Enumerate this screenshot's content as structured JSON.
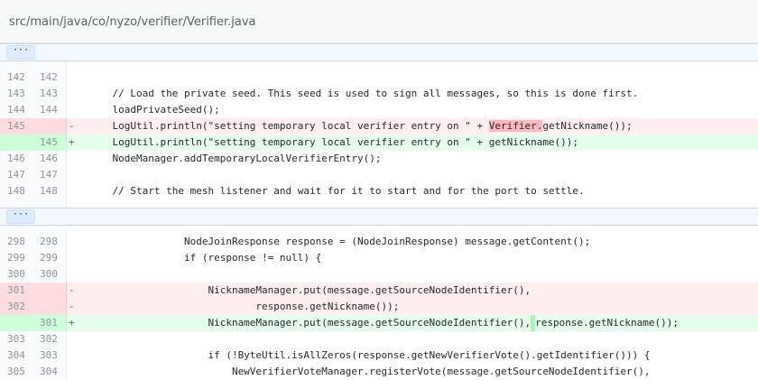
{
  "file": {
    "path": "src/main/java/co/nyzo/verifier/Verifier.java"
  },
  "hunks": [
    {
      "expand_label": "···"
    },
    {
      "expand_label": "···"
    }
  ],
  "colors": {
    "deletion_bg": "#ffeef0",
    "addition_bg": "#e6ffed",
    "deletion_highlight": "#fdb8c0",
    "addition_highlight": "#acf2bd"
  },
  "lines_hunk1": [
    {
      "type": "ctx",
      "old": "142",
      "new": "142",
      "marker": "",
      "code": ""
    },
    {
      "type": "ctx",
      "old": "143",
      "new": "143",
      "marker": "",
      "code": "    // Load the private seed. This seed is used to sign all messages, so this is done first."
    },
    {
      "type": "ctx",
      "old": "144",
      "new": "144",
      "marker": "",
      "code": "    loadPrivateSeed();"
    },
    {
      "type": "del",
      "old": "145",
      "new": "",
      "marker": "-",
      "code_pre": "    LogUtil.println(\"setting temporary local verifier entry on \" + ",
      "code_hl": "Verifier.",
      "code_post": "getNickname());"
    },
    {
      "type": "add",
      "old": "",
      "new": "145",
      "marker": "+",
      "code": "    LogUtil.println(\"setting temporary local verifier entry on \" + getNickname());"
    },
    {
      "type": "ctx",
      "old": "146",
      "new": "146",
      "marker": "",
      "code": "    NodeManager.addTemporaryLocalVerifierEntry();"
    },
    {
      "type": "ctx",
      "old": "147",
      "new": "147",
      "marker": "",
      "code": ""
    },
    {
      "type": "ctx",
      "old": "148",
      "new": "148",
      "marker": "",
      "code": "    // Start the mesh listener and wait for it to start and for the port to settle."
    }
  ],
  "lines_hunk2": [
    {
      "type": "ctx",
      "old": "298",
      "new": "298",
      "marker": "",
      "code": "                NodeJoinResponse response = (NodeJoinResponse) message.getContent();"
    },
    {
      "type": "ctx",
      "old": "299",
      "new": "299",
      "marker": "",
      "code": "                if (response != null) {"
    },
    {
      "type": "ctx",
      "old": "300",
      "new": "300",
      "marker": "",
      "code": ""
    },
    {
      "type": "del",
      "old": "301",
      "new": "",
      "marker": "-",
      "code": "                    NicknameManager.put(message.getSourceNodeIdentifier(),"
    },
    {
      "type": "del",
      "old": "302",
      "new": "",
      "marker": "-",
      "code": "                            response.getNickname());"
    },
    {
      "type": "add",
      "old": "",
      "new": "301",
      "marker": "+",
      "code_pre": "                    NicknameManager.put(message.getSourceNodeIdentifier(),",
      "code_hl": " ",
      "code_post": "response.getNickname());"
    },
    {
      "type": "ctx",
      "old": "303",
      "new": "302",
      "marker": "",
      "code": ""
    },
    {
      "type": "ctx",
      "old": "304",
      "new": "303",
      "marker": "",
      "code": "                    if (!ByteUtil.isAllZeros(response.getNewVerifierVote().getIdentifier())) {"
    },
    {
      "type": "ctx",
      "old": "305",
      "new": "304",
      "marker": "",
      "code": "                        NewVerifierVoteManager.registerVote(message.getSourceNodeIdentifier(),"
    }
  ]
}
